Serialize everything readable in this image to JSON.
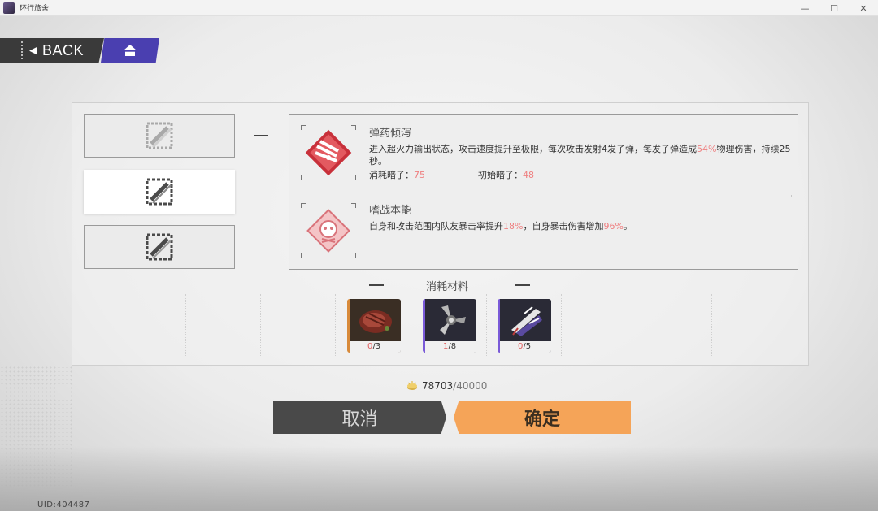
{
  "window": {
    "title": "环行旅舍",
    "controls": {
      "minimize": "—",
      "maximize": "☐",
      "close": "✕"
    }
  },
  "nav": {
    "back_label": "BACK",
    "home_icon": "home-icon"
  },
  "skill_tabs": [
    {
      "icon": "skill-slot-icon",
      "active": false
    },
    {
      "icon": "skill-slot-icon",
      "active": true
    },
    {
      "icon": "skill-slot-icon",
      "active": false
    }
  ],
  "skills": [
    {
      "icon": "ammo-barrage-icon",
      "title": "弹药倾泻",
      "desc_parts": [
        "进入超火力输出状态，攻击速度提升至极限，每次攻击发射4发子弹，每发子弹造成",
        "54%",
        "物理伤害，持续25秒。"
      ],
      "cost_label": "消耗暗子：",
      "cost_value": "75",
      "initial_label": "初始暗子：",
      "initial_value": "48"
    },
    {
      "icon": "battle-instinct-icon",
      "title": "嗜战本能",
      "desc_parts": [
        "自身和攻击范围内队友暴击率提升",
        "18%",
        "，自身暴击伤害增加",
        "96%",
        "。"
      ]
    }
  ],
  "materials": {
    "title": "消耗材料",
    "items": [
      {
        "icon": "meat-icon",
        "have": "0",
        "need": "/3"
      },
      {
        "icon": "propeller-part-icon",
        "have": "1",
        "need": "/8"
      },
      {
        "icon": "ship-model-icon",
        "have": "0",
        "need": "/5"
      }
    ]
  },
  "currency": {
    "icon": "coin-icon",
    "current": "78703",
    "required": "/40000"
  },
  "buttons": {
    "cancel": "取消",
    "confirm": "确定"
  },
  "uid": "UID:404487",
  "colors": {
    "accent_orange": "#f5a458",
    "nav_purple": "#4a3fb0",
    "highlight_red": "#ef7f80"
  }
}
